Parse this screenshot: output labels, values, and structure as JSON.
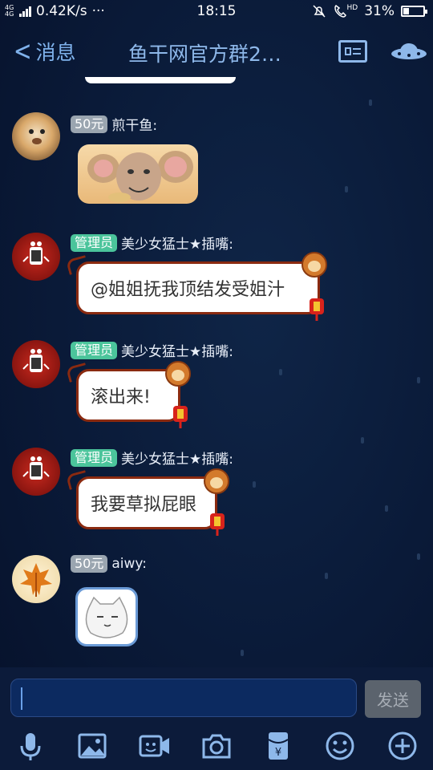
{
  "status_bar": {
    "network_type": "4G 4G",
    "speed": "0.42K/s",
    "dots": "···",
    "time": "18:15",
    "battery": "31%",
    "hd": "HD"
  },
  "header": {
    "back_label": "消息",
    "title": "鱼干网官方群2…"
  },
  "messages": [
    {
      "badge": "50元",
      "name": "煎干鱼:",
      "content_type": "image"
    },
    {
      "badge": "管理员",
      "name": "美少女猛士★插嘴:",
      "text": "@姐姐抚我顶结发受姐汁"
    },
    {
      "badge": "管理员",
      "name": "美少女猛士★插嘴:",
      "text": "滚出来!"
    },
    {
      "badge": "管理员",
      "name": "美少女猛士★插嘴:",
      "text": "我要草拟屁眼"
    },
    {
      "badge": "50元",
      "name": "aiwy:",
      "content_type": "image"
    }
  ],
  "input": {
    "value": "",
    "send_label": "发送"
  },
  "toolbar": {
    "icons": [
      "microphone-icon",
      "image-icon",
      "video-call-icon",
      "camera-icon",
      "red-packet-icon",
      "emoji-icon",
      "plus-icon"
    ]
  },
  "colors": {
    "accent": "#8eb8ea",
    "admin_badge": "#4bc49b",
    "amount_badge": "#9aa5b0",
    "bubble_border": "#8a2a10"
  }
}
